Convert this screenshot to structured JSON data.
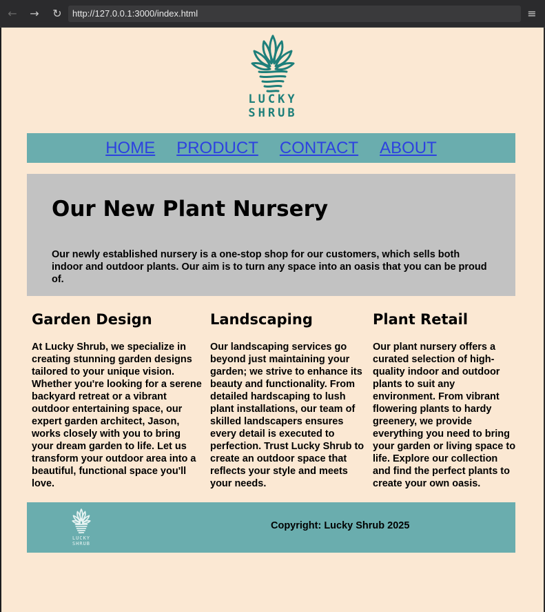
{
  "browser": {
    "url": "http://127.0.0.1:3000/index.html",
    "back_icon": "←",
    "forward_icon": "→",
    "reload_icon": "↻",
    "menu_icon": "≡"
  },
  "logo": {
    "line1": "LUCKY",
    "line2": "SHRUB"
  },
  "nav": {
    "items": [
      "HOME",
      "PRODUCT",
      "CONTACT",
      "ABOUT"
    ]
  },
  "hero": {
    "title": "Our New Plant Nursery",
    "text": "Our newly established nursery is a one-stop shop for our customers, which sells both indoor and outdoor plants. Our aim is to turn any space into an oasis that you can be proud of."
  },
  "columns": [
    {
      "title": "Garden Design",
      "text": "At Lucky Shrub, we specialize in creating stunning garden designs tailored to your unique vision. Whether you're looking for a serene backyard retreat or a vibrant outdoor entertaining space, our expert garden architect, Jason, works closely with you to bring your dream garden to life. Let us transform your outdoor area into a beautiful, functional space you'll love."
    },
    {
      "title": "Landscaping",
      "text": "Our landscaping services go beyond just maintaining your garden; we strive to enhance its beauty and functionality. From detailed hardscaping to lush plant installations, our team of skilled landscapers ensures every detail is executed to perfection. Trust Lucky Shrub to create an outdoor space that reflects your style and meets your needs."
    },
    {
      "title": "Plant Retail",
      "text": "Our plant nursery offers a curated selection of high-quality indoor and outdoor plants to suit any environment. From vibrant flowering plants to hardy greenery, we provide everything you need to bring your garden or living space to life. Explore our collection and find the perfect plants to create your own oasis."
    }
  ],
  "footer": {
    "copyright": "Copyright: Lucky Shrub 2025",
    "logo_line1": "LUCKY",
    "logo_line2": "SHRUB"
  },
  "colors": {
    "page_bg": "#fbe8d3",
    "teal": "#6aadae",
    "logo_teal": "#1e7f7a",
    "hero_bg": "#c2c2c2",
    "link": "#2d41e0"
  }
}
